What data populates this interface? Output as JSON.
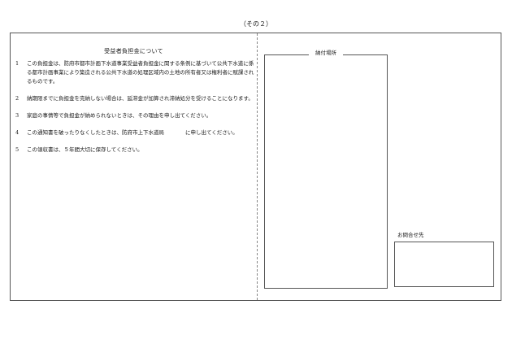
{
  "page_label": "（その２）",
  "left": {
    "title": "受益者負担金について",
    "terms": [
      {
        "num": "1",
        "text": "この負担金は、防府市都市計画下水道事業受益者負担金に関する条例に基づいて公共下水道に係る都市計画事業により築造される公共下水道の処理区域内の土地の所有者又は権利者に賦課されるものです。"
      },
      {
        "num": "2",
        "text": "納期限までに負担金を完納しない場合は、延滞金が加算され滞納処分を受けることになります。"
      },
      {
        "num": "3",
        "text": "家庭の事情等で負担金が納められないときは、その理由を申し出てください。"
      },
      {
        "num": "4",
        "text": "この通知書を破ったりなくしたときは、防府市上下水道局　　　　に申し出てください。"
      },
      {
        "num": "5",
        "text": "この領収書は、５年間大切に保存してください。"
      }
    ]
  },
  "right": {
    "payment_place_label": "納付場所",
    "inquiry_label": "お問合せ先"
  }
}
